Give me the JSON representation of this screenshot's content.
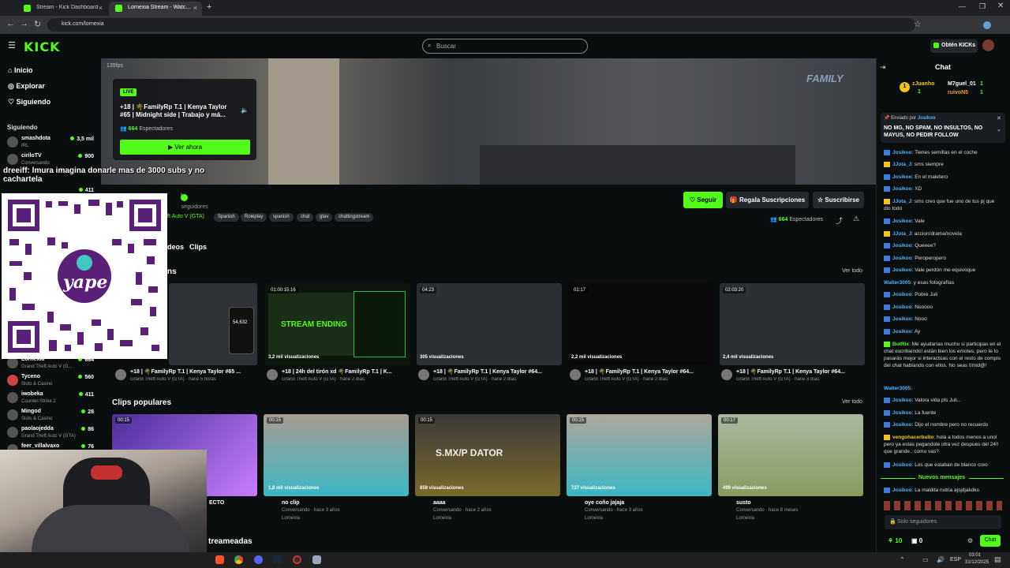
{
  "browser": {
    "tabs": [
      {
        "title": "Stream - Kick Dashboard"
      },
      {
        "title": "Lornexia Stream - Watch Li..."
      }
    ],
    "url": "kick.com/lornexia"
  },
  "header": {
    "logo": "KICK",
    "search_placeholder": "Buscar",
    "kicks_button": "Obtén KICKs"
  },
  "sidebar": {
    "nav": [
      "Inicio",
      "Explorar",
      "Siguiendo"
    ],
    "following_heading": "Siguiendo",
    "channels_top": [
      {
        "name": "smashdota",
        "game": "IRL",
        "viewers": "3,5 mil"
      },
      {
        "name": "ciriloTV",
        "game": "Conversando",
        "viewers": "900"
      },
      {
        "name": "...",
        "game": "...",
        "viewers": "411"
      }
    ],
    "channels_bottom": [
      {
        "name": "Lornexia",
        "game": "Grand Theft Auto V (G...",
        "viewers": "664"
      },
      {
        "name": "Tyceno",
        "game": "Slots & Casino",
        "viewers": "560"
      },
      {
        "name": "iwobeka",
        "game": "Counter-Strike 2",
        "viewers": "411"
      },
      {
        "name": "Mingod",
        "game": "Slots & Casino",
        "viewers": "28"
      },
      {
        "name": "paolaojedda",
        "game": "Grand Theft Auto V (GTA)",
        "viewers": "86"
      },
      {
        "name": "feer_villalvaxo",
        "game": "",
        "viewers": "76"
      }
    ]
  },
  "player": {
    "fps": "135fps",
    "live_badge": "LIVE",
    "live_title": "+18 | 🌴FamilyRp T.1 | Kenya Taylor #65 | Midnight side | Trabajo y má...",
    "live_viewers_count": "664",
    "live_viewers_label": "Espectadores",
    "watch_now": "Ver ahora",
    "watermark": "FAMILY"
  },
  "overlay": {
    "alert_text": "dreeiff: lmura imagina donarle mas de 3000 subs y no cachartela",
    "qr_brand": "yape"
  },
  "channel": {
    "name": "ia",
    "followers": "seguidores",
    "category": "ft Auto V (GTA)",
    "tags": [
      "Spanish",
      "Roleplay",
      "spanish",
      "chat",
      "gtav",
      "chattingstream"
    ],
    "follow": "Seguir",
    "gift_subs": "Regala Suscripciones",
    "subscribe": "Suscribirse",
    "viewers_count": "664",
    "viewers_label": "Espectadores",
    "tabs": [
      "deos",
      "Clips"
    ]
  },
  "vods": {
    "heading": "ns",
    "see_all": "Ver todo",
    "items": [
      {
        "duration": "",
        "views": "",
        "title": "+18 | 🌴FamilyRp T.1 | Kenya Taylor #65 ...",
        "meta": "Grand Theft Auto V (GTA) · hace 5 horas"
      },
      {
        "duration": "01:00:15:16",
        "views": "3,2 mil visualizaciones",
        "title": "+18 | 24h del tirón xd 🌴FamilyRp T.1 | K...",
        "meta": "Grand Theft Auto V (GTA) · hace 2 días"
      },
      {
        "duration": "04:23",
        "views": "305 visualizaciones",
        "title": "+18 | 🌴FamilyRp T.1 | Kenya Taylor #64...",
        "meta": "Grand Theft Auto V (GTA) · hace 2 días"
      },
      {
        "duration": "01:17",
        "views": "2,2 mil visualizaciones",
        "title": "+18 | 🌴FamilyRp T.1 | Kenya Taylor #64...",
        "meta": "Grand Theft Auto V (GTA) · hace 2 días"
      },
      {
        "duration": "02:03:20",
        "views": "2,4 mil visualizaciones",
        "title": "+18 | 🌴FamilyRp T.1 | Kenya Taylor #64...",
        "meta": "Grand Theft Auto V (GTA) · hace 3 días"
      }
    ],
    "thumb2_text": "STREAM ENDING",
    "thumb1_number": "54,632"
  },
  "clips": {
    "heading": "Clips populares",
    "see_all": "Ver todo",
    "items": [
      {
        "duration": "00:15",
        "views": "",
        "title": "ECTO",
        "meta": "",
        "author": ""
      },
      {
        "duration": "00:15",
        "views": "1,8 mil visualizaciones",
        "title": "no clip",
        "meta": "Conversando · hace 3 años",
        "author": "Lornexia"
      },
      {
        "duration": "00:15",
        "views": "859 visualizaciones",
        "title": "aaaa",
        "meta": "Conversando · hace 2 años",
        "author": "Lornexia"
      },
      {
        "duration": "00:15",
        "views": "727 visualizaciones",
        "title": "oye coño jajaja",
        "meta": "Conversando · hace 3 años",
        "author": "Lornexia"
      },
      {
        "duration": "00:17",
        "views": "499 visualizaciones",
        "title": "susto",
        "meta": "Conversando · hace 8 meses",
        "author": "Lornexia"
      }
    ],
    "clip3_text": "S.MX/P  DATOR"
  },
  "bottom_heading": "treameadas",
  "chat": {
    "title": "Chat",
    "gifters": [
      {
        "name": "zJuanho",
        "count": "1"
      },
      {
        "name": "M7guel_01",
        "count": "1"
      },
      {
        "name": "ruivoN5",
        "count": "1"
      }
    ],
    "pinned_by_label": "Enviado por",
    "pinned_by": "Josikoo",
    "pinned_text": "NO MG, NO SPAM, NO INSULTOS, NO MAYUS, NO PEDIR FOLLOW",
    "messages": [
      {
        "user": "Josikoo",
        "text": "Tienes semillas en el coche"
      },
      {
        "user": "JJota_J",
        "text": "sms siempre"
      },
      {
        "user": "Josikoo",
        "text": "En el maletero"
      },
      {
        "user": "Josikoo",
        "text": "XD"
      },
      {
        "user": "JJota_J",
        "text": "sms creo que fue uno de tus pj que dio todo"
      },
      {
        "user": "Josikoo",
        "text": "Vale"
      },
      {
        "user": "JJota_J",
        "text": "accion/drama/novela"
      },
      {
        "user": "Josikoo",
        "text": "Queeee?"
      },
      {
        "user": "Josikoo",
        "text": "Peroperopero"
      },
      {
        "user": "Josikoo",
        "text": "Vale perdón me equivoque"
      },
      {
        "user": "Walter3005",
        "text": "y esas fotografías"
      },
      {
        "user": "Josikoo",
        "text": "Pobre Juli"
      },
      {
        "user": "Josikoo",
        "text": "Nooooo"
      },
      {
        "user": "Josikoo",
        "text": "Nooo"
      },
      {
        "user": "Josikoo",
        "text": "Ay"
      },
      {
        "user": "BotRix",
        "text": "Me ayudarías mucho si participas en el chat escribiendo! están bien los emotes, pero te lo pasarás mejor si interactúas con el resto de compis del chat hablando con ellos. No seas tímid@!"
      },
      {
        "user": "Walter3005",
        "text": ""
      },
      {
        "user": "Josikoo",
        "text": "Valora vida pls Juli..."
      },
      {
        "user": "Josikoo",
        "text": "La fuente"
      },
      {
        "user": "Josikoo",
        "text": "Dijo el nombre pero no recuerdo"
      },
      {
        "user": "vengohacerbulto",
        "text": "hola a todos menos a uno! pero ya estas pegandole otra vez despues del 24!! que grande.. como vas?"
      },
      {
        "user": "Josikoo",
        "text": "Los que estaban de blanco creo"
      }
    ],
    "new_messages": "Nuevos mensajes",
    "last_message": {
      "user": "Josikoo",
      "text": "La maldita nutria ajsjdjakdks"
    },
    "input_placeholder": "Solo seguidores",
    "points": "10",
    "subs_count": "0",
    "send_button": "Chat"
  },
  "taskbar": {
    "lang": "ESP",
    "time": "03:01",
    "date": "31/12/2025"
  },
  "colors": {
    "accent": "#53fc18",
    "bg": "#0b0e0f",
    "chat_user": "#4fb3ff"
  }
}
